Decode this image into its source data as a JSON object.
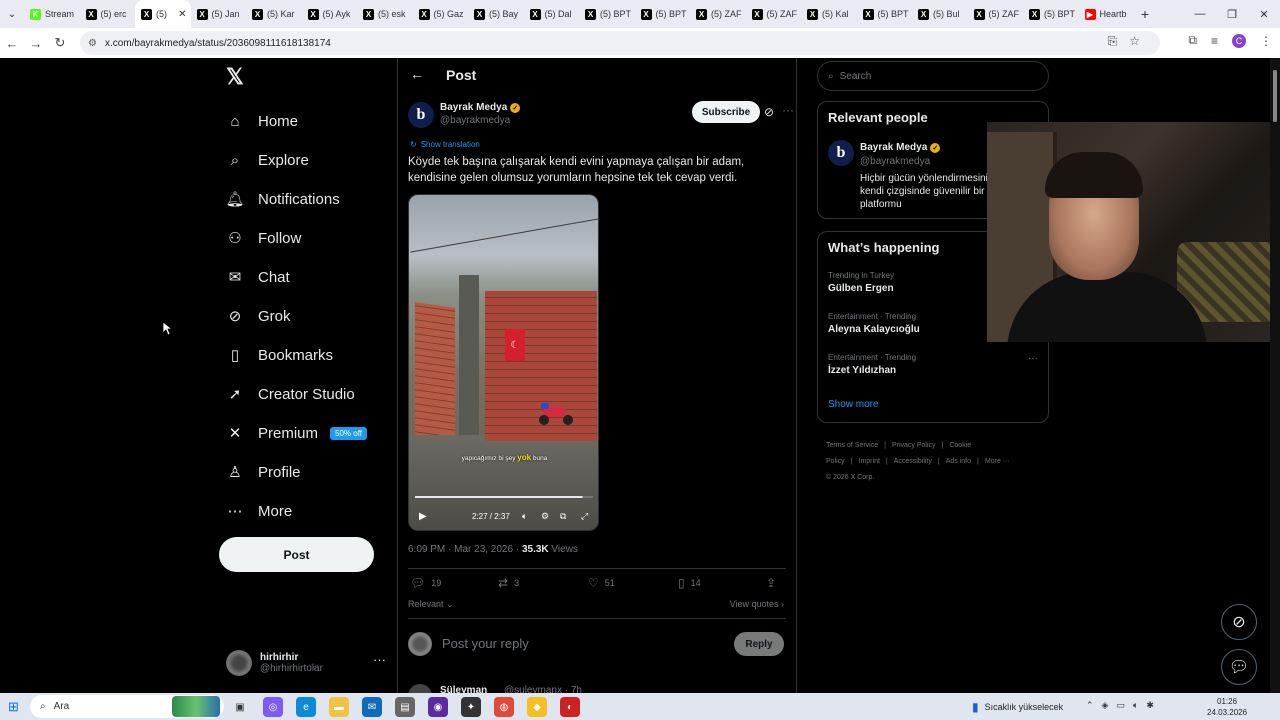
{
  "browser": {
    "tabs": [
      {
        "title": "Stream",
        "color": "#53fc18",
        "glyph": "K"
      },
      {
        "title": "(5) erc",
        "color": "#000000",
        "glyph": "X"
      },
      {
        "title": "(5)",
        "color": "#000000",
        "glyph": "X",
        "active": true
      },
      {
        "title": "(5) Jan",
        "color": "#000000",
        "glyph": "X"
      },
      {
        "title": "(5) Kar",
        "color": "#000000",
        "glyph": "X"
      },
      {
        "title": "(5) Ayk",
        "color": "#000000",
        "glyph": "X"
      },
      {
        "title": "(5) esk",
        "color": "#000000",
        "glyph": "X"
      },
      {
        "title": "(5) Gaz",
        "color": "#000000",
        "glyph": "X"
      },
      {
        "title": "(5) Bay",
        "color": "#000000",
        "glyph": "X"
      },
      {
        "title": "(5) Dal",
        "color": "#000000",
        "glyph": "X"
      },
      {
        "title": "(5) BPT",
        "color": "#000000",
        "glyph": "X"
      },
      {
        "title": "(5) BPT",
        "color": "#000000",
        "glyph": "X"
      },
      {
        "title": "(5) ZAF",
        "color": "#000000",
        "glyph": "X"
      },
      {
        "title": "(5) ZAF",
        "color": "#000000",
        "glyph": "X"
      },
      {
        "title": "(5) Kal",
        "color": "#000000",
        "glyph": "X"
      },
      {
        "title": "(5) BPT",
        "color": "#000000",
        "glyph": "X"
      },
      {
        "title": "(5) Bul",
        "color": "#000000",
        "glyph": "X"
      },
      {
        "title": "(5) ZAF",
        "color": "#000000",
        "glyph": "X"
      },
      {
        "title": "(5) BPT",
        "color": "#000000",
        "glyph": "X"
      },
      {
        "title": "Heartb",
        "color": "#ff0000",
        "glyph": "▶"
      }
    ],
    "url": "x.com/bayrakmedya/status/2036098111618138174",
    "profile_initial": "C"
  },
  "nav": {
    "items": [
      {
        "label": "Home",
        "icon": "home-icon",
        "glyph": "⌂"
      },
      {
        "label": "Explore",
        "icon": "search-icon",
        "glyph": "⌕"
      },
      {
        "label": "Notifications",
        "icon": "bell-icon",
        "glyph": "🔔︎",
        "badge": "5"
      },
      {
        "label": "Follow",
        "icon": "add-person-icon",
        "glyph": "⚇"
      },
      {
        "label": "Chat",
        "icon": "mail-icon",
        "glyph": "✉"
      },
      {
        "label": "Grok",
        "icon": "grok-icon",
        "glyph": "⊘",
        "dot": true
      },
      {
        "label": "Bookmarks",
        "icon": "bookmark-icon",
        "glyph": "▯"
      },
      {
        "label": "Creator Studio",
        "icon": "rocket-icon",
        "glyph": "➚"
      },
      {
        "label": "Premium",
        "icon": "x-icon",
        "glyph": "✕",
        "promo": "50% off"
      },
      {
        "label": "Profile",
        "icon": "person-icon",
        "glyph": "♙"
      },
      {
        "label": "More",
        "icon": "more-circle-icon",
        "glyph": "⋯"
      }
    ],
    "post_button": "Post",
    "account": {
      "name": "hirhirhir",
      "handle": "@hirhirhirtolar"
    }
  },
  "post": {
    "header_title": "Post",
    "author_name": "Bayrak Medya",
    "author_handle": "@bayrakmedya",
    "subscribe_label": "Subscribe",
    "show_translation": "Show translation",
    "text": "Köyde tek başına çalışarak kendi evini yapmaya çalışan bir adam, kendisine gelen olumsuz yorumların hepsine tek tek cevap verdi.",
    "video": {
      "subtitle_pre": "yapıcağımız bi şey",
      "subtitle_hl": "yok",
      "subtitle_post": "buna",
      "time": "2:27 / 2:37",
      "progress": 0.94
    },
    "timestamp": "6:09 PM · Mar 23, 2026 · ",
    "views_count": "35.3K",
    "views_label": " Views",
    "replies": "19",
    "reposts": "3",
    "likes": "51",
    "bookmarks": "14",
    "sort_label": "Relevant",
    "view_quotes": "View quotes",
    "reply_placeholder": "Post your reply",
    "reply_button": "Reply",
    "next_reply_name": "Süleyman",
    "next_reply_handle": "@suleymanx · 7h"
  },
  "right": {
    "search_placeholder": "Search",
    "relevant_title": "Relevant people",
    "relevant_name": "Bayrak Medya",
    "relevant_handle": "@bayrakmedya",
    "relevant_bio": "Hiçbir gücün yönlendirmesini duymadan kendi çizgisinde güvenilir bir haber platformu",
    "happening_title": "What’s happening",
    "trends": [
      {
        "context": "Trending in Turkey",
        "name": "Gülben Ergen"
      },
      {
        "context": "Entertainment · Trending",
        "name": "Aleyna Kalaycıoğlu"
      },
      {
        "context": "Entertainment · Trending",
        "name": "İzzet Yıldızhan"
      }
    ],
    "show_more": "Show more",
    "footer": [
      "Terms of Service",
      "|",
      "Privacy Policy",
      "|",
      "Cookie Policy",
      "|",
      "Imprint",
      "|",
      "Accessibility",
      "|",
      "Ads info",
      "|",
      "More ···"
    ],
    "copyright": "© 2026 X Corp."
  },
  "taskbar": {
    "search_label": "Ara",
    "weather": "Sıcaklık yükselecek",
    "time": "01:26",
    "date": "24.03.2026"
  }
}
